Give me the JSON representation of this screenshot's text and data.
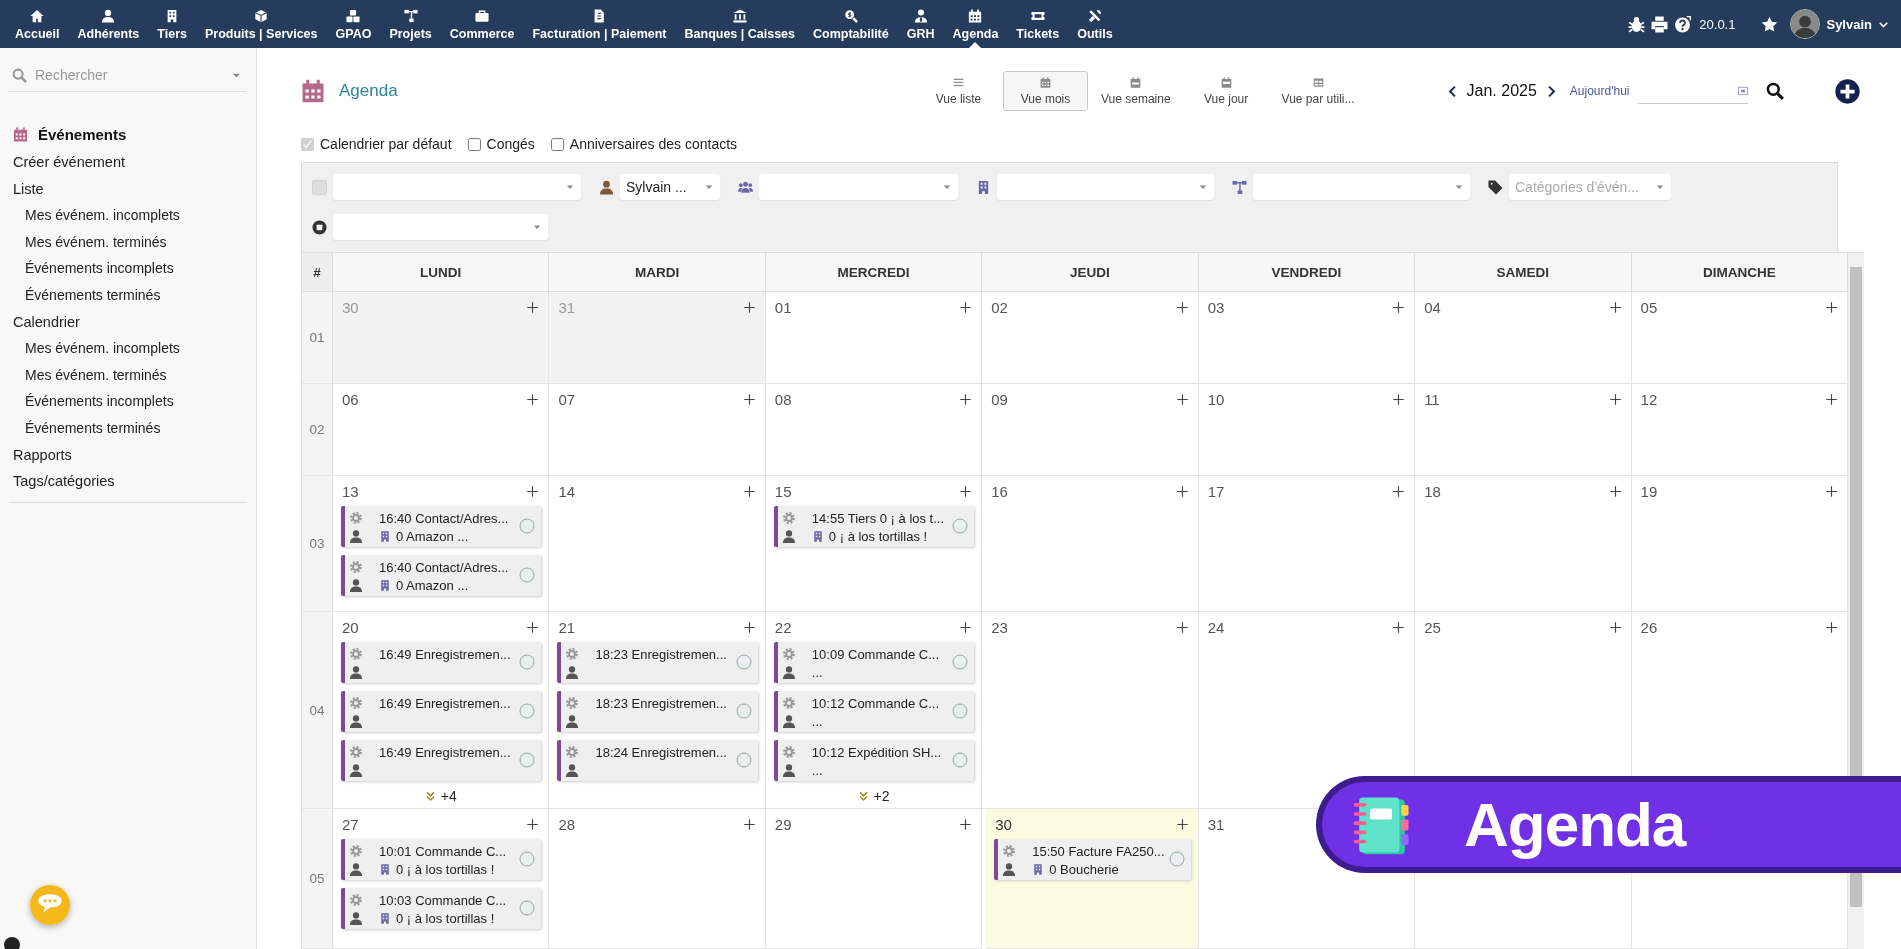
{
  "nav": {
    "items": [
      {
        "label": "Accueil",
        "selected": false
      },
      {
        "label": "Adhérents",
        "selected": false
      },
      {
        "label": "Tiers",
        "selected": false
      },
      {
        "label": "Produits | Services",
        "selected": false
      },
      {
        "label": "GPAO",
        "selected": false
      },
      {
        "label": "Projets",
        "selected": false
      },
      {
        "label": "Commerce",
        "selected": false
      },
      {
        "label": "Facturation | Paiement",
        "selected": false
      },
      {
        "label": "Banques | Caisses",
        "selected": false
      },
      {
        "label": "Comptabilité",
        "selected": false
      },
      {
        "label": "GRH",
        "selected": false
      },
      {
        "label": "Agenda",
        "selected": true
      },
      {
        "label": "Tickets",
        "selected": false
      },
      {
        "label": "Outils",
        "selected": false
      }
    ],
    "version": "20.0.1",
    "user": "Sylvain"
  },
  "sidebar": {
    "search": {
      "placeholder": "Rechercher"
    },
    "menu": {
      "title": "Événements",
      "items": [
        {
          "label": "Créer événement"
        },
        {
          "label": "Liste",
          "children": [
            {
              "label": "Mes événem. incomplets"
            },
            {
              "label": "Mes événem. terminés"
            },
            {
              "label": "Événements incomplets"
            },
            {
              "label": "Événements terminés"
            }
          ]
        },
        {
          "label": "Calendrier",
          "children": [
            {
              "label": "Mes événem. incomplets"
            },
            {
              "label": "Mes événem. terminés"
            },
            {
              "label": "Événements incomplets"
            },
            {
              "label": "Événements terminés"
            }
          ]
        },
        {
          "label": "Rapports"
        },
        {
          "label": "Tags/catégories"
        }
      ]
    }
  },
  "page": {
    "title": "Agenda",
    "views": [
      {
        "label": "Vue liste",
        "selected": false
      },
      {
        "label": "Vue mois",
        "selected": true
      },
      {
        "label": "Vue semaine",
        "selected": false
      },
      {
        "label": "Vue jour",
        "selected": false
      },
      {
        "label": "Vue par utili...",
        "selected": false
      }
    ],
    "period": "Jan. 2025",
    "today_link": "Aujourd'hui"
  },
  "calendars": [
    {
      "label": "Calendrier par défaut",
      "checked": true,
      "disabled": true
    },
    {
      "label": "Congés",
      "checked": false,
      "disabled": false
    },
    {
      "label": "Anniversaires des contacts",
      "checked": false,
      "disabled": false
    }
  ],
  "filters": [
    {
      "kind": "checkbox",
      "checked": false,
      "disabled": true
    },
    {
      "kind": "user",
      "value": "Sylvain ..."
    },
    {
      "kind": "group"
    },
    {
      "kind": "company"
    },
    {
      "kind": "project"
    },
    {
      "kind": "tag",
      "placeholder": "Catégories d'évén..."
    },
    {
      "kind": "status"
    }
  ],
  "calendar": {
    "columns": [
      "#",
      "LUNDI",
      "MARDI",
      "MERCREDI",
      "JEUDI",
      "VENDREDI",
      "SAMEDI",
      "DIMANCHE"
    ],
    "weeks": [
      {
        "number": "01",
        "days": [
          {
            "day": "30",
            "other_month": true,
            "today": false
          },
          {
            "day": "31",
            "other_month": true,
            "today": false
          },
          {
            "day": "01",
            "other_month": false,
            "today": false
          },
          {
            "day": "02",
            "other_month": false,
            "today": false
          },
          {
            "day": "03",
            "other_month": false,
            "today": false
          },
          {
            "day": "04",
            "other_month": false,
            "today": false
          },
          {
            "day": "05",
            "other_month": false,
            "today": false
          }
        ]
      },
      {
        "number": "02",
        "days": [
          {
            "day": "06",
            "other_month": false,
            "today": false
          },
          {
            "day": "07",
            "other_month": false,
            "today": false
          },
          {
            "day": "08",
            "other_month": false,
            "today": false
          },
          {
            "day": "09",
            "other_month": false,
            "today": false
          },
          {
            "day": "10",
            "other_month": false,
            "today": false
          },
          {
            "day": "11",
            "other_month": false,
            "today": false
          },
          {
            "day": "12",
            "other_month": false,
            "today": false
          }
        ]
      },
      {
        "number": "03",
        "days": [
          {
            "day": "13",
            "other_month": false,
            "today": false,
            "events": [
              {
                "title": "16:40 Contact/Adres...",
                "company": "0 Amazon ..."
              },
              {
                "title": "16:40 Contact/Adres...",
                "company": "0 Amazon ..."
              }
            ]
          },
          {
            "day": "14",
            "other_month": false,
            "today": false
          },
          {
            "day": "15",
            "other_month": false,
            "today": false,
            "events": [
              {
                "title": "14:55 Tiers 0 ¡ à los t...",
                "company": "0 ¡ à los tortillas !"
              }
            ]
          },
          {
            "day": "16",
            "other_month": false,
            "today": false
          },
          {
            "day": "17",
            "other_month": false,
            "today": false
          },
          {
            "day": "18",
            "other_month": false,
            "today": false
          },
          {
            "day": "19",
            "other_month": false,
            "today": false
          }
        ]
      },
      {
        "number": "04",
        "days": [
          {
            "day": "20",
            "other_month": false,
            "today": false,
            "events": [
              {
                "title": "16:49 Enregistremen..."
              },
              {
                "title": "16:49 Enregistremen..."
              },
              {
                "title": "16:49 Enregistremen..."
              }
            ],
            "more": "+4"
          },
          {
            "day": "21",
            "other_month": false,
            "today": false,
            "events": [
              {
                "title": "18:23 Enregistremen..."
              },
              {
                "title": "18:23 Enregistremen..."
              },
              {
                "title": "18:24 Enregistremen..."
              }
            ]
          },
          {
            "day": "22",
            "other_month": false,
            "today": false,
            "events": [
              {
                "title": "10:09 Commande C...",
                "note": "..."
              },
              {
                "title": "10:12 Commande C...",
                "note": "..."
              },
              {
                "title": "10:12 Expédition SH...",
                "note": "..."
              }
            ],
            "more": "+2"
          },
          {
            "day": "23",
            "other_month": false,
            "today": false
          },
          {
            "day": "24",
            "other_month": false,
            "today": false
          },
          {
            "day": "25",
            "other_month": false,
            "today": false
          },
          {
            "day": "26",
            "other_month": false,
            "today": false
          }
        ]
      },
      {
        "number": "05",
        "days": [
          {
            "day": "27",
            "other_month": false,
            "today": false,
            "events": [
              {
                "title": "10:01 Commande C...",
                "company": "0 ¡ à los tortillas !"
              },
              {
                "title": "10:03 Commande C...",
                "company": "0 ¡ à los tortillas !"
              }
            ]
          },
          {
            "day": "28",
            "other_month": false,
            "today": false
          },
          {
            "day": "29",
            "other_month": false,
            "today": false
          },
          {
            "day": "30",
            "other_month": false,
            "today": true,
            "events": [
              {
                "title": "15:50 Facture FA250...",
                "company": "0 Boucherie"
              }
            ]
          },
          {
            "day": "31",
            "other_month": false,
            "today": false
          },
          {
            "other_month": false,
            "today": false
          },
          {
            "other_month": false,
            "today": false
          }
        ]
      }
    ]
  },
  "promo_banner": {
    "text": "Agenda"
  }
}
